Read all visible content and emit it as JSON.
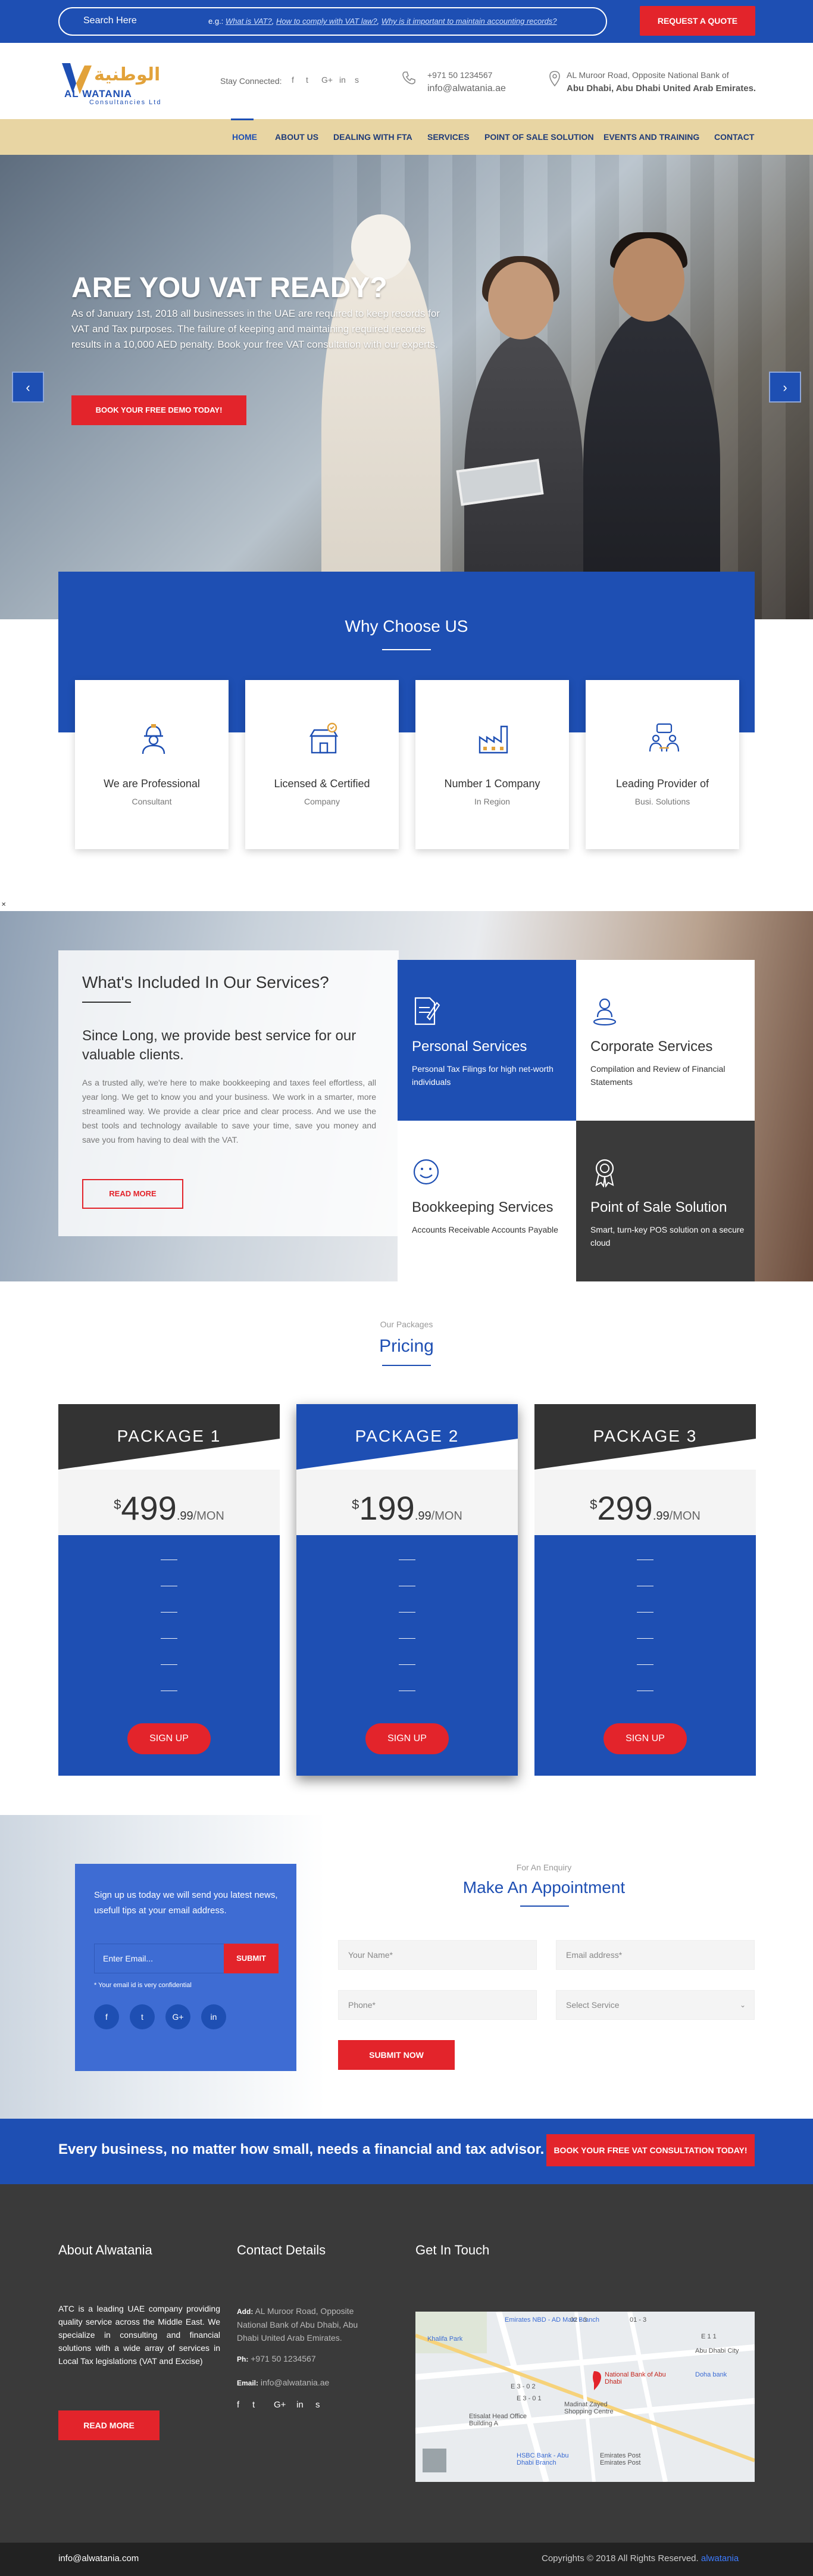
{
  "topbar": {
    "search_label": "Search Here",
    "hint_prefix": "e.g.:",
    "hint_links": [
      "What is VAT?",
      "How to comply with VAT law?",
      "Why is it important to maintain accounting records?"
    ],
    "quote_button": "REQUEST A QUOTE"
  },
  "header": {
    "logo_arabic": "الوطنية",
    "logo_name": "AL WATANIA",
    "logo_sub": "Consultancies Ltd",
    "stay_connected": "Stay Connected:",
    "social": [
      "f",
      "t",
      "G+",
      "in",
      "s"
    ],
    "phone": "+971 50 1234567",
    "email": "info@alwatania.ae",
    "address_line1": "AL Muroor Road, Opposite National Bank of",
    "address_line2": "Abu Dhabi, Abu Dhabi United Arab Emirates."
  },
  "nav": {
    "items": [
      "HOME",
      "ABOUT US",
      "DEALING WITH FTA",
      "SERVICES",
      "POINT OF SALE SOLUTION",
      "EVENTS AND TRAINING",
      "CONTACT"
    ],
    "active": "HOME"
  },
  "hero": {
    "title": "ARE YOU VAT READY?",
    "text": "As of January 1st, 2018 all businesses in the UAE are required to keep records for VAT and Tax purposes. The failure of keeping and maintaining required records results in a 10,000 AED penalty. Book your free VAT consultation with our experts.",
    "button": "BOOK YOUR FREE DEMO TODAY!",
    "prev": "‹",
    "next": "›"
  },
  "why": {
    "title": "Why Choose US",
    "cards": [
      {
        "title": "We are Professional",
        "sub": "Consultant",
        "icon": "worker-icon"
      },
      {
        "title": "Licensed & Certified",
        "sub": "Company",
        "icon": "certified-shop-icon"
      },
      {
        "title": "Number 1 Company",
        "sub": "In Region",
        "icon": "factory-icon"
      },
      {
        "title": "Leading Provider of",
        "sub": "Busi. Solutions",
        "icon": "team-icon"
      }
    ]
  },
  "services": {
    "title": "What's Included In Our Services?",
    "subtitle": "Since Long, we provide best service for our valuable clients.",
    "text": "As a trusted ally, we're here to make bookkeeping and taxes feel effortless, all year long. We get to know you and your business. We work in a smarter, more streamlined way. We provide a clear price and clear process. And we use the best tools and technology available to save your time, save you money and save you from having to deal with the VAT.",
    "read_more": "READ MORE",
    "boxes": [
      {
        "title": "Personal Services",
        "desc": "Personal Tax Filings for high net-worth individuals",
        "icon": "document-pen-icon"
      },
      {
        "title": "Corporate Services",
        "desc": "Compilation and Review of Financial Statements",
        "icon": "person-pin-icon"
      },
      {
        "title": "Bookkeeping Services",
        "desc": "Accounts Receivable Accounts Payable",
        "icon": "smiley-icon"
      },
      {
        "title": "Point of Sale Solution",
        "desc": "Smart, turn-key POS solution on a secure cloud",
        "icon": "award-badge-icon"
      }
    ]
  },
  "pricing": {
    "small": "Our Packages",
    "title": "Pricing",
    "packages": [
      {
        "name": "PACKAGE 1",
        "currency": "$",
        "amount": "499",
        "cents": ".99",
        "per": "/MON",
        "button": "SIGN UP"
      },
      {
        "name": "PACKAGE 2",
        "currency": "$",
        "amount": "199",
        "cents": ".99",
        "per": "/MON",
        "button": "SIGN UP"
      },
      {
        "name": "PACKAGE 3",
        "currency": "$",
        "amount": "299",
        "cents": ".99",
        "per": "/MON",
        "button": "SIGN UP"
      }
    ],
    "feature_placeholder": "——"
  },
  "newsletter": {
    "text": "Sign up us today we will send you latest news, usefull tips at your email address.",
    "email_placeholder": "Enter Email...",
    "submit": "SUBMIT",
    "note": "* Your email id is very confidential",
    "social": [
      "f",
      "t",
      "G+",
      "in"
    ]
  },
  "appointment": {
    "small": "For An Enquiry",
    "title": "Make An Appointment",
    "name_placeholder": "Your Name*",
    "email_placeholder": "Email address*",
    "phone_placeholder": "Phone*",
    "service_placeholder": "Select Service",
    "submit": "SUBMIT NOW"
  },
  "banner": {
    "text": "Every business, no matter how small, needs a financial and tax advisor.",
    "button": "BOOK YOUR FREE VAT CONSULTATION TODAY!"
  },
  "footer": {
    "about_title": "About Alwatania",
    "about_text": "ATC is a leading UAE company providing quality service across the Middle East. We specialize in consulting and financial solutions with a wide array of services in Local Tax legislations (VAT and Excise)",
    "read_more": "READ MORE",
    "contact_title": "Contact Details",
    "addr_label": "Add:",
    "addr": "AL Muroor Road, Opposite National Bank of Abu Dhabi, Abu Dhabi United Arab Emirates.",
    "ph_label": "Ph:",
    "phone": "+971 50 1234567",
    "email_label": "Email:",
    "email": "info@alwatania.ae",
    "social": [
      "f",
      "t",
      "G+",
      "in",
      "s"
    ],
    "touch_title": "Get In Touch",
    "map_labels": [
      "Emirates NBD - AD Main Branch",
      "Khalifa Park",
      "National Bank of Abu Dhabi",
      "Madinat Zayed Shopping Centre",
      "Etisalat Head Office Building A",
      "HSBC Bank - Abu Dhabi Branch",
      "Emirates Post Emirates Post",
      "Doha bank",
      "Abu Dhabi City"
    ],
    "map_road_labels": [
      "E 3 - 0 2",
      "E 3 - 0 1",
      "E 1 1",
      "02 - 3",
      "01 - 3"
    ]
  },
  "bottom": {
    "email": "info@alwatania.com",
    "copyright": "Copyrights © 2018 All Rights Reserved.",
    "brand": "alwatania"
  },
  "colors": {
    "primary": "#1e4fb3",
    "accent": "#e3242b",
    "nav": "#e8d5a3",
    "dark": "#333333"
  }
}
